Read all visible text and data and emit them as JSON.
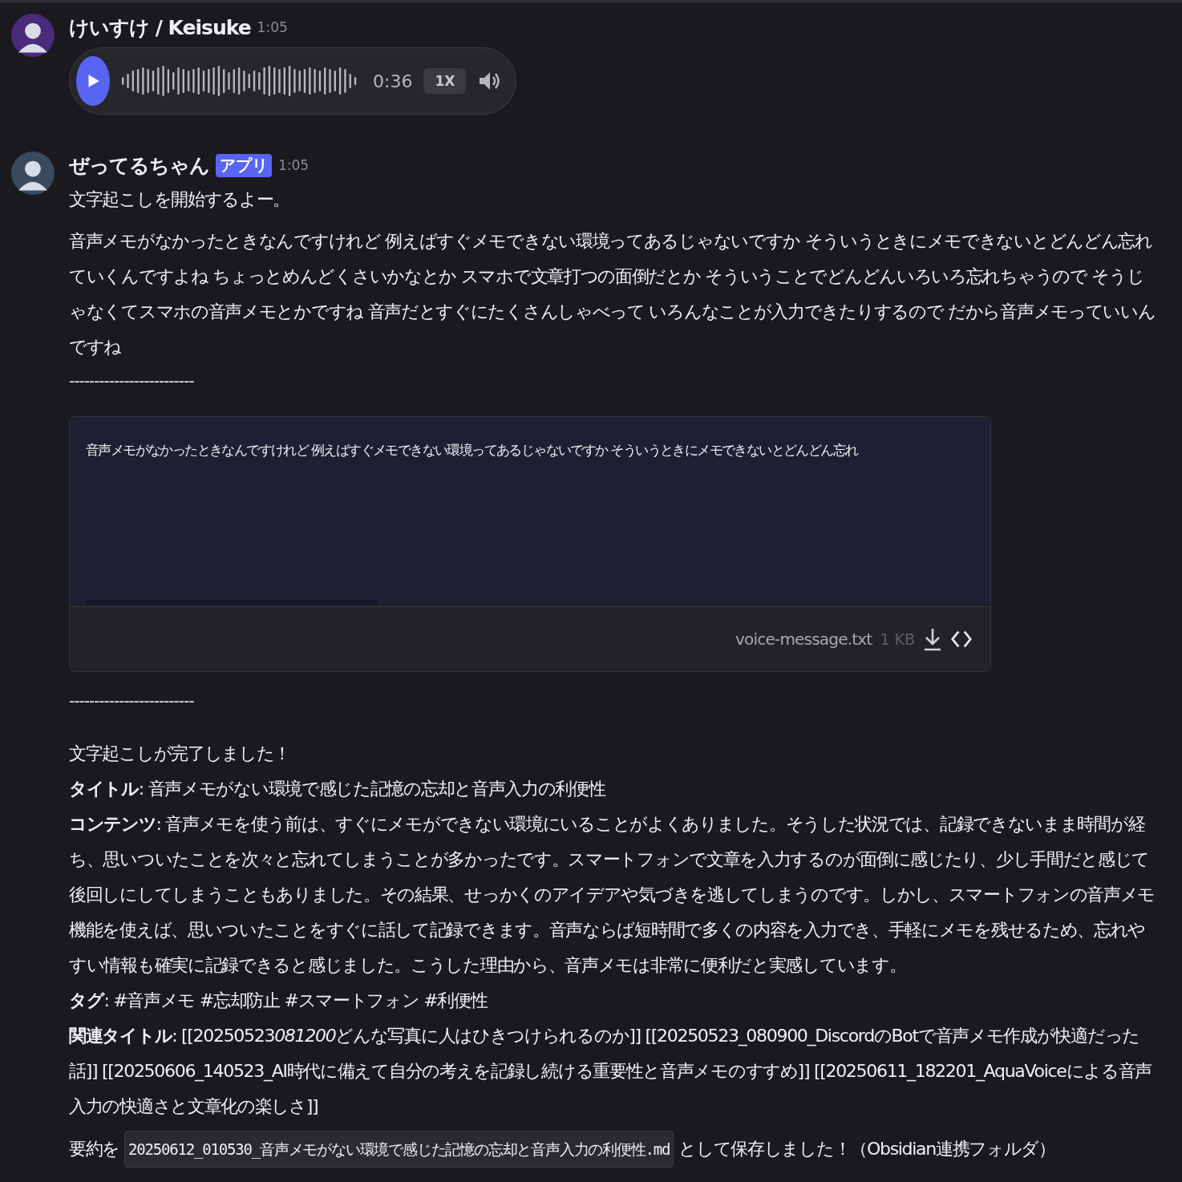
{
  "messages": [
    {
      "kind": "voice",
      "author": "けいすけ / Keisuke",
      "time": "1:05",
      "audio": {
        "duration": "0:36",
        "speed": "1X"
      }
    },
    {
      "kind": "bot",
      "author": "ぜってるちゃん",
      "badge": "アプリ",
      "time": "1:05",
      "intro": "文字起こしを開始するよー。",
      "transcript": "音声メモがなかったときなんですけれど 例えばすぐメモできない環境ってあるじゃないですか そういうときにメモできないとどんどん忘れていくんですよね ちょっとめんどくさいかなとか スマホで文章打つの面倒だとか そういうことでどんどんいろいろ忘れちゃうので そうじゃなくてスマホの音声メモとかですね 音声だとすぐにたくさんしゃべって いろんなことが入力できたりするので だから音声メモっていいんですね",
      "separator": "-------------------------",
      "file": {
        "preview": "音声メモがなかったときなんですけれど  例えばすぐメモできない環境ってあるじゃないですか  そういうときにメモできないとどんどん忘れ",
        "name": "voice-message.txt",
        "size": "1 KB"
      },
      "separator_after": "-------------------------",
      "done": "文字起こしが完了しました！",
      "fields": [
        {
          "segments": [
            {
              "text": "**タイトル**: 音声メモがない環境で感じた記憶の忘却と音声入力の利便性",
              "italic": false
            }
          ]
        },
        {
          "segments": [
            {
              "text": "**コンテンツ**: 音声メモを使う前は、すぐにメモができない環境にいることがよくありました。そうした状況では、記録できないまま時間が経ち、思いついたことを次々と忘れてしまうことが多かったです。スマートフォンで文章を入力するのが面倒に感じたり、少し手間だと感じて後回しにしてしまうこともありました。その結果、せっかくのアイデアや気づきを逃してしまうのです。しかし、スマートフォンの音声メモ機能を使えば、思いついたことをすぐに話して記録できます。音声ならば短時間で多くの内容を入力でき、手軽にメモを残せるため、忘れやすい情報も確実に記録できると感じました。こうした理由から、音声メモは非常に便利だと実感しています。",
              "italic": false
            }
          ]
        },
        {
          "segments": [
            {
              "text": "**タグ**: #音声メモ #忘却防止 #スマートフォン #利便性",
              "italic": false
            }
          ]
        },
        {
          "segments": [
            {
              "text": "**関連タイトル**: [[20250523",
              "italic": false
            },
            {
              "text": "081200",
              "italic": true
            },
            {
              "text": "どんな写真に人はひきつけられるのか]] [[20250523_080900_DiscordのBotで音声メモ作成が快適だった話]] [[20250606_140523_AI時代に備えて自分の考えを記録し続ける重要性と音声メモのすすめ]] [[20250611_182201_AquaVoiceによる音声入力の快適さと文章化の楽しさ]]",
              "italic": false
            }
          ]
        }
      ],
      "saved": {
        "prefix": "要約を",
        "filename": "20250612_010530_音声メモがない環境で感じた記憶の忘却と音声入力の利便性.md",
        "suffix": "として保存しました！（Obsidian連携フォルダ）"
      }
    }
  ]
}
